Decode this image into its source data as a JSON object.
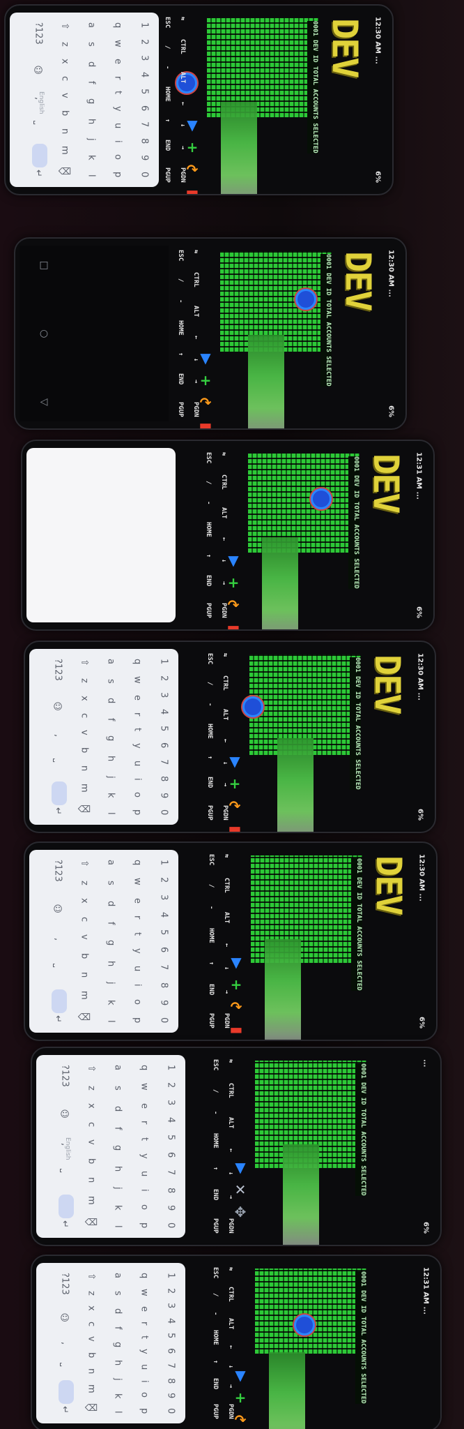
{
  "scene": {
    "background": "#140a10"
  },
  "phones": [
    {
      "clock": "12:30 AM ...",
      "battery": "6%",
      "logo": "DEV",
      "term_label": "0001 DEV ID TOTAL ACCOUNTS SELECTED",
      "extra_keys": [
        "ESC",
        "/",
        "-",
        "HOME",
        "↑",
        "END",
        "PGUP"
      ],
      "extra_keys_2": [
        "⇆",
        "CTRL",
        "ALT",
        "←",
        "↓",
        "→",
        "PGDN"
      ],
      "keyboard": "letters",
      "keyboard_lang": "English",
      "tools": [
        "▼",
        "+",
        "↷",
        "▬",
        "✱",
        "✥"
      ]
    },
    {
      "clock": "12:30 AM ...",
      "battery": "6%",
      "logo": "DEV",
      "term_label": "0001 DEV ID TOTAL ACCOUNTS SELECTED",
      "extra_keys": [
        "ESC",
        "/",
        "-",
        "HOME",
        "↑",
        "END",
        "PGUP"
      ],
      "extra_keys_2": [
        "⇆",
        "CTRL",
        "ALT",
        "←",
        "↓",
        "→",
        "PGDN"
      ],
      "keyboard": "none",
      "keyboard_lang": "",
      "tools": [
        "▼",
        "+",
        "↷",
        "▬",
        "✱",
        "✥"
      ]
    },
    {
      "clock": "12:31 AM ...",
      "battery": "6%",
      "logo": "DEV",
      "term_label": "0001 DEV ID TOTAL ACCOUNTS SELECTED",
      "extra_keys": [
        "ESC",
        "/",
        "-",
        "HOME",
        "↑",
        "END",
        "PGUP"
      ],
      "extra_keys_2": [
        "⇆",
        "CTRL",
        "ALT",
        "←",
        "↓",
        "→",
        "PGDN"
      ],
      "keyboard": "blank",
      "keyboard_lang": "",
      "tools": [
        "▼",
        "+",
        "↷",
        "▬",
        "✱",
        "✥"
      ]
    },
    {
      "clock": "12:30 AM ...",
      "battery": "6%",
      "logo": "DEV",
      "term_label": "0001 DEV ID TOTAL ACCOUNTS SELECTED",
      "extra_keys": [
        "ESC",
        "/",
        "-",
        "HOME",
        "↑",
        "END",
        "PGUP"
      ],
      "extra_keys_2": [
        "⇆",
        "CTRL",
        "ALT",
        "←",
        "↓",
        "→",
        "PGDN"
      ],
      "keyboard": "letters",
      "keyboard_lang": "",
      "tools": [
        "▼",
        "+",
        "↷",
        "▬",
        "✱",
        "✥"
      ]
    },
    {
      "clock": "12:30 AM ...",
      "battery": "6%",
      "logo": "DEV",
      "term_label": "0001 DEV ID TOTAL ACCOUNTS SELECTED",
      "extra_keys": [
        "ESC",
        "/",
        "-",
        "HOME",
        "↑",
        "END",
        "PGUP"
      ],
      "extra_keys_2": [
        "⇆",
        "CTRL",
        "ALT",
        "←",
        "↓",
        "→",
        "PGDN"
      ],
      "keyboard": "letters",
      "keyboard_lang": "",
      "tools": [
        "▼",
        "+",
        "↷",
        "▬",
        "✱",
        "✥"
      ]
    },
    {
      "clock": "...",
      "battery": "6%",
      "logo": "",
      "term_label": "0001 DEV ID TOTAL ACCOUNTS SELECTED",
      "extra_keys": [
        "ESC",
        "/",
        "-",
        "HOME",
        "↑",
        "END",
        "PGUP"
      ],
      "extra_keys_2": [
        "⇆",
        "CTRL",
        "ALT",
        "←",
        "↓",
        "→",
        "PGDN"
      ],
      "keyboard": "letters",
      "keyboard_lang": "English",
      "tools": [
        "▼",
        "✕",
        "✥"
      ]
    },
    {
      "clock": "12:31 AM ...",
      "battery": "",
      "logo": "",
      "term_label": "0001 DEV ID TOTAL ACCOUNTS SELECTED",
      "extra_keys": [
        "ESC",
        "/",
        "-",
        "HOME",
        "↑",
        "END",
        "PGUP"
      ],
      "extra_keys_2": [
        "⇆",
        "CTRL",
        "ALT",
        "←",
        "↓",
        "→",
        "PGDN"
      ],
      "keyboard": "letters",
      "keyboard_lang": "",
      "tools": [
        "▼",
        "+",
        "↷",
        "▬",
        "✱",
        "✥"
      ]
    }
  ],
  "keyboard_rows": [
    [
      "1",
      "2",
      "3",
      "4",
      "5",
      "6",
      "7",
      "8",
      "9",
      "0"
    ],
    [
      "q",
      "w",
      "e",
      "r",
      "t",
      "y",
      "u",
      "i",
      "o",
      "p"
    ],
    [
      "a",
      "s",
      "d",
      "f",
      "g",
      "h",
      "j",
      "k",
      "l"
    ],
    [
      "⇧",
      "z",
      "x",
      "c",
      "v",
      "b",
      "n",
      "m",
      "⌫"
    ],
    [
      "?123",
      "☺",
      ",",
      "⎵",
      ".",
      "↵"
    ]
  ]
}
